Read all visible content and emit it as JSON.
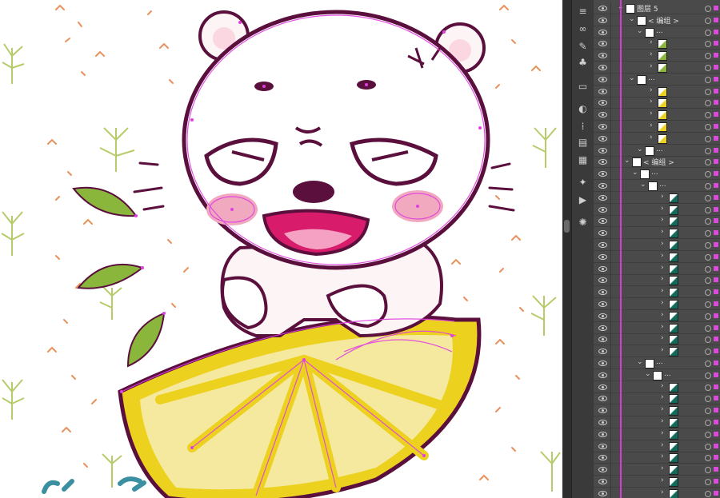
{
  "document": {
    "artwork_subject": "angry-bear-on-lemon-slice",
    "colors": {
      "path_highlight": "#e040e0",
      "outline": "#5a0f3c",
      "lemon_fill": "#f5e9a0",
      "lemon_rind": "#ecd21f",
      "leaf": "#8bb63c",
      "cheek": "#f0a9be",
      "mouth": "#d81b6a",
      "sprinkle": "#e8915a",
      "dill": "#b6cc6a"
    }
  },
  "toolstrip": {
    "icons": [
      "layers-icon",
      "links-icon",
      "brush-icon",
      "club-icon",
      "rect-icon",
      "pie-icon",
      "grid-icon",
      "align-icon",
      "shape-icon",
      "magic-wand-icon",
      "play-icon",
      "gear-icon"
    ]
  },
  "layers_panel": {
    "top_layer_name": "图层 5",
    "group_label": "< 编组 >",
    "ellipsis_label": "...",
    "accent": "#d94cd9"
  }
}
